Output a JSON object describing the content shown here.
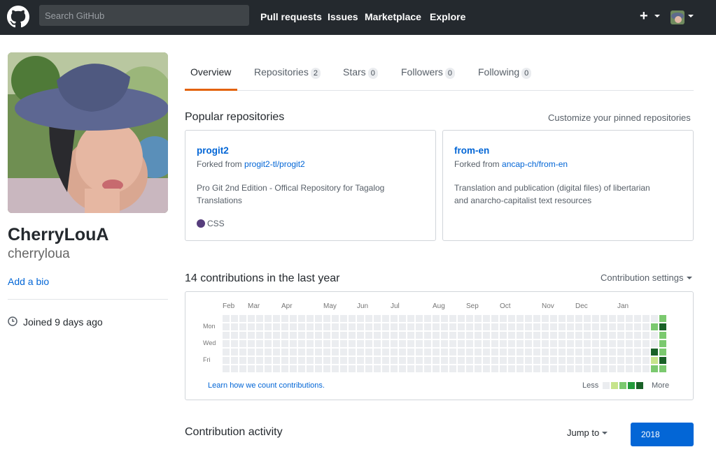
{
  "header": {
    "search_placeholder": "Search GitHub",
    "nav": [
      "Pull requests",
      "Issues",
      "Marketplace",
      "Explore"
    ],
    "plus_label": "+"
  },
  "profile": {
    "fullname": "CherryLouA",
    "username": "cherryloua",
    "add_bio": "Add a bio",
    "joined": "Joined 9 days ago"
  },
  "tabs": [
    {
      "label": "Overview"
    },
    {
      "label": "Repositories",
      "count": "2"
    },
    {
      "label": "Stars",
      "count": "0"
    },
    {
      "label": "Followers",
      "count": "0"
    },
    {
      "label": "Following",
      "count": "0"
    }
  ],
  "popular": {
    "title": "Popular repositories",
    "customize": "Customize your pinned repositories",
    "repos": [
      {
        "name": "progit2",
        "forked_prefix": "Forked from ",
        "forked_from": "progit2-tl/progit2",
        "description": "Pro Git 2nd Edition - Offical Repository for Tagalog Translations",
        "language": "CSS",
        "language_color": "#563d7c"
      },
      {
        "name": "from-en",
        "forked_prefix": "Forked from ",
        "forked_from": "ancap-ch/from-en",
        "description": "Translation and publication (digital files) of libertarian and anarcho-capitalist text resources"
      }
    ]
  },
  "contributions": {
    "title": "14 contributions in the last year",
    "settings": "Contribution settings",
    "months": [
      "Feb",
      "Mar",
      "Apr",
      "May",
      "Jun",
      "Jul",
      "Aug",
      "Sep",
      "Oct",
      "Nov",
      "Dec",
      "Jan"
    ],
    "weekdays": [
      "Mon",
      "Wed",
      "Fri"
    ],
    "learn": "Learn how we count contributions.",
    "less": "Less",
    "more": "More",
    "colors": [
      "#ebedf0",
      "#c6e48b",
      "#7bc96f",
      "#239a3b",
      "#196127"
    ]
  },
  "activity": {
    "title": "Contribution activity",
    "jump_to": "Jump to",
    "year": "2018"
  }
}
